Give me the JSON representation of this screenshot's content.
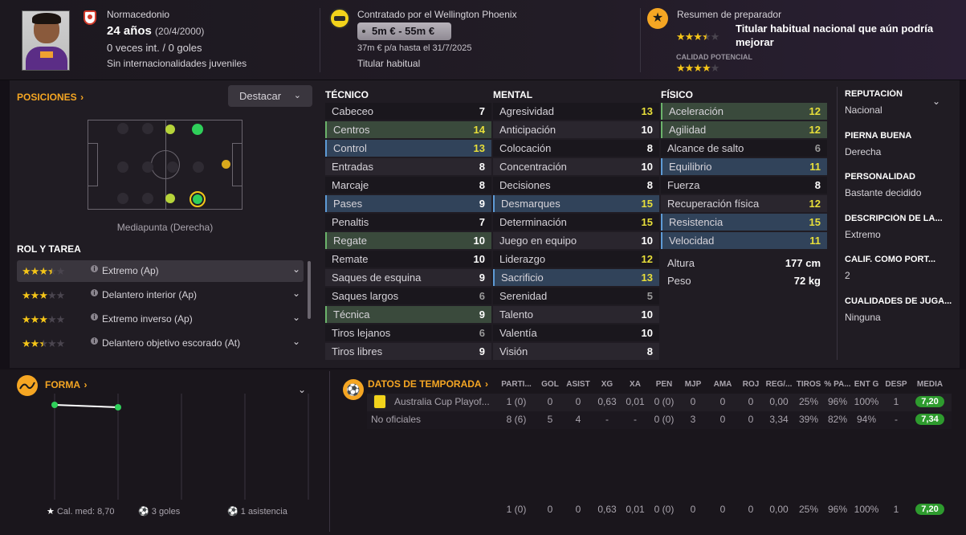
{
  "header": {
    "club_name": "Normacedonio",
    "age": "24 años",
    "dob": "(20/4/2000)",
    "caps": "0 veces int. / 0 goles",
    "youth": "Sin internacionalidades juveniles",
    "contract_title": "Contratado por el Wellington Phoenix",
    "value": "5m € - 55m €",
    "wage": "37m € p/a hasta el 31/7/2025",
    "status": "Titular habitual",
    "scout_title": "Resumen de preparador",
    "scout_text": "Titular habitual nacional que aún podría mejorar",
    "current_ability": 3.5,
    "potential_label": "CALIDAD POTENCIAL",
    "potential_ability": 4
  },
  "positions": {
    "title": "POSICIONES",
    "highlight": "Destacar",
    "role_label": "Mediapunta (Derecha)"
  },
  "roles": {
    "title": "ROL Y TAREA",
    "items": [
      {
        "label": "Extremo (Ap)",
        "stars": 3.5
      },
      {
        "label": "Delantero interior (Ap)",
        "stars": 3
      },
      {
        "label": "Extremo inverso (Ap)",
        "stars": 3
      },
      {
        "label": "Delantero objetivo escorado (At)",
        "stars": 2.5
      }
    ]
  },
  "attributes": {
    "tecnico": {
      "title": "TÉCNICO",
      "items": [
        {
          "n": "Cabeceo",
          "v": "7",
          "h": ""
        },
        {
          "n": "Centros",
          "v": "14",
          "h": "g"
        },
        {
          "n": "Control",
          "v": "13",
          "h": "b"
        },
        {
          "n": "Entradas",
          "v": "8",
          "h": ""
        },
        {
          "n": "Marcaje",
          "v": "8",
          "h": ""
        },
        {
          "n": "Pases",
          "v": "9",
          "h": "b"
        },
        {
          "n": "Penaltis",
          "v": "7",
          "h": ""
        },
        {
          "n": "Regate",
          "v": "10",
          "h": "g"
        },
        {
          "n": "Remate",
          "v": "10",
          "h": ""
        },
        {
          "n": "Saques de esquina",
          "v": "9",
          "h": ""
        },
        {
          "n": "Saques largos",
          "v": "6",
          "h": ""
        },
        {
          "n": "Técnica",
          "v": "9",
          "h": "g"
        },
        {
          "n": "Tiros lejanos",
          "v": "6",
          "h": ""
        },
        {
          "n": "Tiros libres",
          "v": "9",
          "h": ""
        }
      ]
    },
    "mental": {
      "title": "MENTAL",
      "items": [
        {
          "n": "Agresividad",
          "v": "13",
          "h": ""
        },
        {
          "n": "Anticipación",
          "v": "10",
          "h": ""
        },
        {
          "n": "Colocación",
          "v": "8",
          "h": ""
        },
        {
          "n": "Concentración",
          "v": "10",
          "h": ""
        },
        {
          "n": "Decisiones",
          "v": "8",
          "h": ""
        },
        {
          "n": "Desmarques",
          "v": "15",
          "h": "b"
        },
        {
          "n": "Determinación",
          "v": "15",
          "h": ""
        },
        {
          "n": "Juego en equipo",
          "v": "10",
          "h": ""
        },
        {
          "n": "Liderazgo",
          "v": "12",
          "h": ""
        },
        {
          "n": "Sacrificio",
          "v": "13",
          "h": "b"
        },
        {
          "n": "Serenidad",
          "v": "5",
          "h": ""
        },
        {
          "n": "Talento",
          "v": "10",
          "h": ""
        },
        {
          "n": "Valentía",
          "v": "10",
          "h": ""
        },
        {
          "n": "Visión",
          "v": "8",
          "h": ""
        }
      ]
    },
    "fisico": {
      "title": "FÍSICO",
      "items": [
        {
          "n": "Aceleración",
          "v": "12",
          "h": "g"
        },
        {
          "n": "Agilidad",
          "v": "12",
          "h": "g"
        },
        {
          "n": "Alcance de salto",
          "v": "6",
          "h": ""
        },
        {
          "n": "Equilibrio",
          "v": "11",
          "h": "b"
        },
        {
          "n": "Fuerza",
          "v": "8",
          "h": ""
        },
        {
          "n": "Recuperación física",
          "v": "12",
          "h": ""
        },
        {
          "n": "Resistencia",
          "v": "15",
          "h": "b"
        },
        {
          "n": "Velocidad",
          "v": "11",
          "h": "b"
        }
      ]
    },
    "height_label": "Altura",
    "height": "177 cm",
    "weight_label": "Peso",
    "weight": "72 kg"
  },
  "info": [
    {
      "k": "REPUTACIÓN",
      "v": "Nacional"
    },
    {
      "k": "PIERNA BUENA",
      "v": "Derecha"
    },
    {
      "k": "PERSONALIDAD",
      "v": "Bastante decidido"
    },
    {
      "k": "DESCRIPCIÓN DE LA...",
      "v": "Extremo"
    },
    {
      "k": "CALIF. COMO PORT...",
      "v": "2"
    },
    {
      "k": "CUALIDADES DE JUGA...",
      "v": "Ninguna"
    }
  ],
  "form": {
    "title": "FORMA",
    "avg": "Cal. med: 8,70",
    "goals": "3 goles",
    "assists": "1 asistencia",
    "ratings": [
      7.2,
      7.1
    ]
  },
  "season": {
    "title": "DATOS DE TEMPORADA",
    "headers": [
      "PARTI...",
      "GOL",
      "ASIST",
      "XG",
      "XA",
      "PEN",
      "MJP",
      "AMA",
      "ROJ",
      "REG/...",
      "TIROS",
      "% PA...",
      "ENT G",
      "DESP",
      "MEDIA"
    ],
    "rows": [
      {
        "name": "Australia Cup Playof...",
        "vals": [
          "1 (0)",
          "0",
          "0",
          "0,63",
          "0,01",
          "0 (0)",
          "0",
          "0",
          "0",
          "0,00",
          "25%",
          "96%",
          "100%",
          "1",
          "7,20"
        ]
      },
      {
        "name": "No oficiales",
        "vals": [
          "8 (6)",
          "5",
          "4",
          "-",
          "-",
          "0 (0)",
          "3",
          "0",
          "0",
          "3,34",
          "39%",
          "82%",
          "94%",
          "-",
          "7,34"
        ]
      }
    ],
    "total": [
      "1 (0)",
      "0",
      "0",
      "0,63",
      "0,01",
      "0 (0)",
      "0",
      "0",
      "0",
      "0,00",
      "25%",
      "96%",
      "100%",
      "1",
      "7,20"
    ]
  },
  "colors": {
    "accent": "#f5a623",
    "green_badge": "#2e9b2e",
    "highlight_yellow": "#e8df3a"
  }
}
